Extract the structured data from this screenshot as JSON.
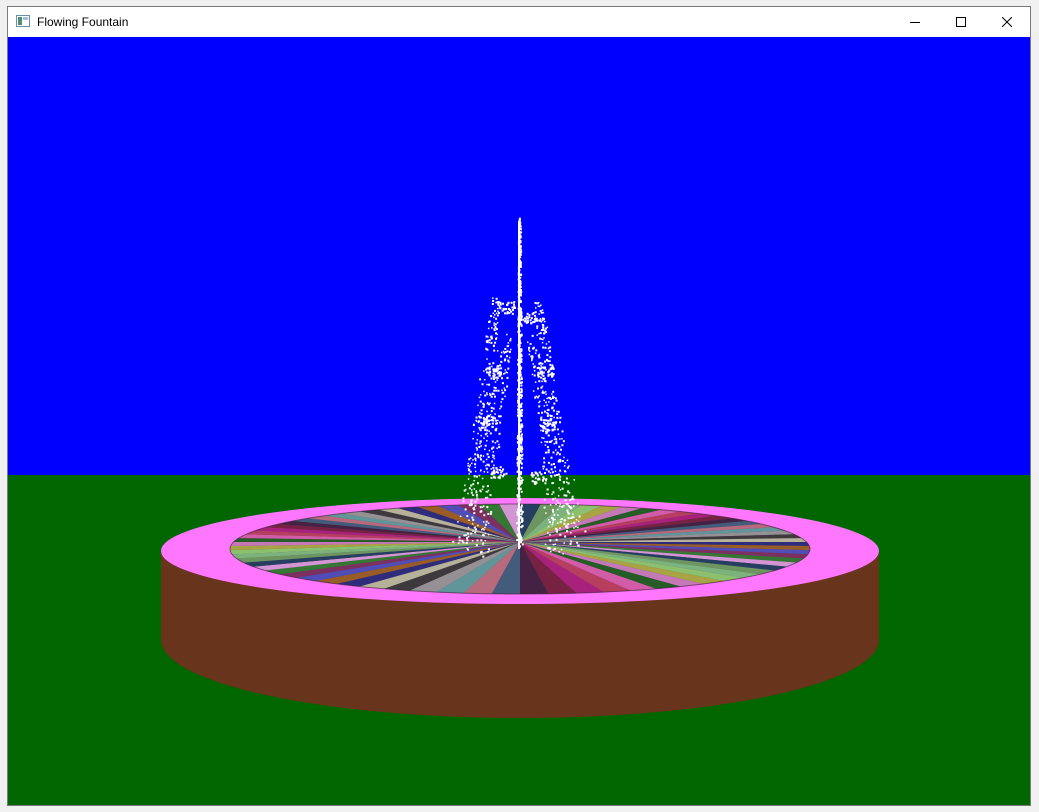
{
  "window": {
    "title": "Flowing Fountain"
  },
  "controls": {
    "minimize_icon": "minimize-icon",
    "maximize_icon": "maximize-icon",
    "close_icon": "close-icon"
  },
  "scene": {
    "sky_color": "#0000ff",
    "ground_color": "#006600",
    "rim_color": "#ff77ff",
    "wall_color": "#68341b",
    "water_color": "#ffffff"
  }
}
